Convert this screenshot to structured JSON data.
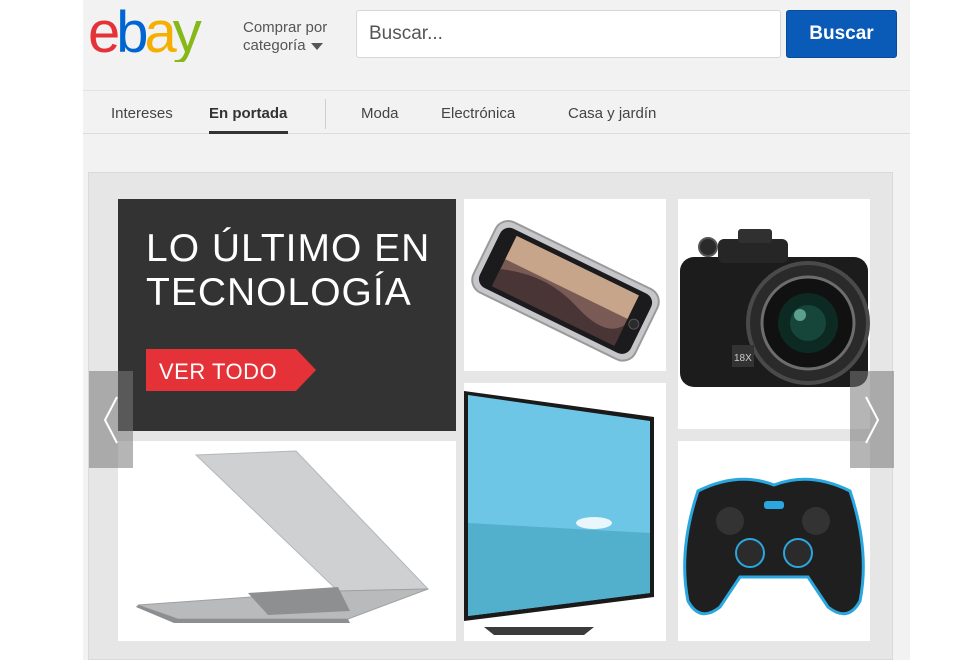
{
  "header": {
    "logo_text": "ebay",
    "category_line1": "Comprar por",
    "category_line2": "categoría",
    "search_placeholder": "Buscar...",
    "search_button": "Buscar"
  },
  "nav": {
    "tabs": [
      {
        "label": "Intereses"
      },
      {
        "label": "En portada"
      },
      {
        "label": "Moda"
      },
      {
        "label": "Electrónica"
      },
      {
        "label": "Casa y jardín"
      }
    ],
    "active_tab": "En portada"
  },
  "hero": {
    "title_line1": "LO ÚLTIMO EN",
    "title_line2": "TECNOLOGÍA",
    "cta_label": "VER TODO"
  },
  "products": [
    {
      "name": "smartphone-image"
    },
    {
      "name": "camera-image"
    },
    {
      "name": "laptop-image"
    },
    {
      "name": "tv-image"
    },
    {
      "name": "gamepad-image"
    }
  ],
  "colors": {
    "search_button": "#0a5ab8",
    "cta": "#e53238",
    "hero_bg": "#333333",
    "logo_e": "#e53238",
    "logo_b": "#0064d2",
    "logo_a": "#f5af02",
    "logo_y": "#86b817"
  }
}
